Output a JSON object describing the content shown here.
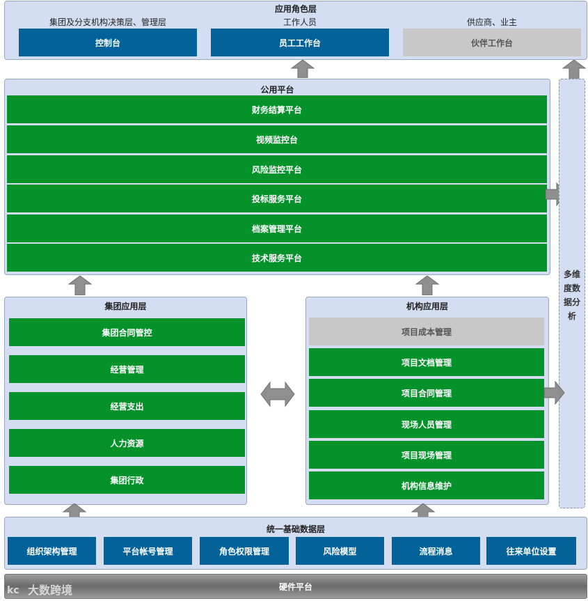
{
  "role_layer": {
    "title": "应用角色层",
    "groups": [
      {
        "subtitle": "集团及分支机构决策层、管理层",
        "label": "控制台"
      },
      {
        "subtitle": "工作人员",
        "label": "员工工作台"
      },
      {
        "subtitle": "供应商、业主",
        "label": "伙伴工作台"
      }
    ]
  },
  "public_platform": {
    "title": "公用平台",
    "items": [
      "财务结算平台",
      "视频监控台",
      "风险监控平台",
      "投标服务平台",
      "档案管理平台",
      "技术服务平台"
    ]
  },
  "group_app_layer": {
    "title": "集团应用层",
    "items": [
      "集团合同管控",
      "经营管理",
      "经营支出",
      "人力资源",
      "集团行政"
    ]
  },
  "org_app_layer": {
    "title": "机构应用层",
    "items": [
      "项目成本管理",
      "项目文档管理",
      "项目合同管理",
      "现场人员管理",
      "项目现场管理",
      "机构信息维护"
    ]
  },
  "analysis": {
    "chars": [
      "多维",
      "度数",
      "据分",
      "析"
    ]
  },
  "data_layer": {
    "title": "统一基础数据层",
    "items": [
      "组织架构管理",
      "平台帐号管理",
      "角色权限管理",
      "风险模型",
      "流程消息",
      "往来单位设置"
    ]
  },
  "hardware": {
    "label": "硬件平台"
  },
  "watermark": {
    "text": "大数跨境"
  },
  "colors": {
    "panel": "#d3def2",
    "green": "#06922b",
    "blue": "#03629a",
    "grey": "#c8c8c8",
    "arrow": "#8f8f8f"
  }
}
